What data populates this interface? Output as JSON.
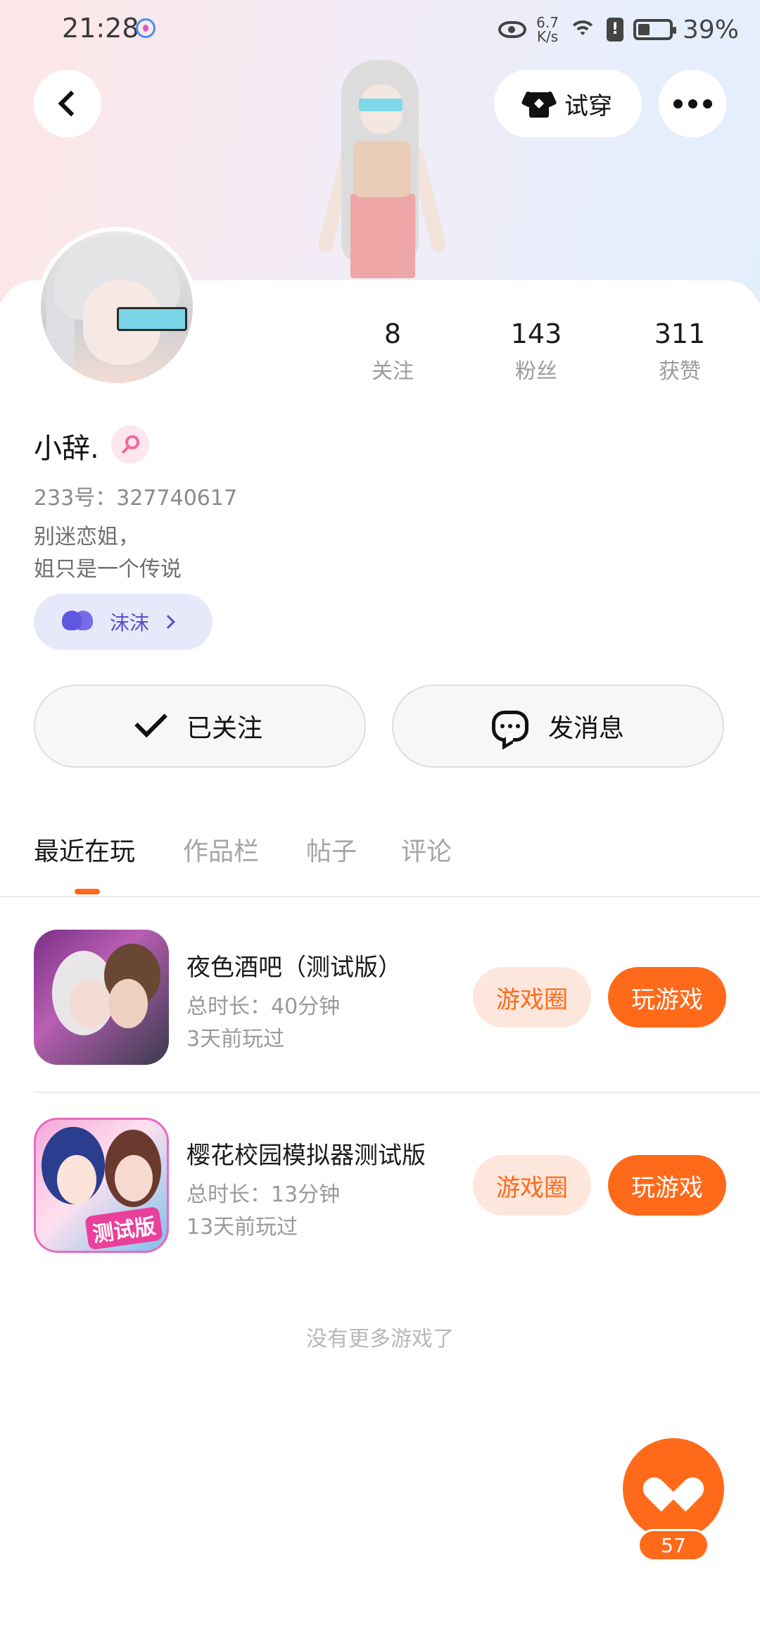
{
  "status_bar": {
    "time": "21:28",
    "net_speed_value": "6.7",
    "net_speed_unit": "K/s",
    "battery": "39%"
  },
  "header": {
    "try_on_label": "试穿",
    "icons": [
      "back-icon",
      "shirt-icon",
      "more-icon"
    ]
  },
  "profile": {
    "name": "小辞.",
    "gender": "female",
    "uid": "233号：327740617",
    "bio_line1": "别迷恋姐，",
    "bio_line2": "姐只是一个传说",
    "couple_label": "沫沫",
    "stats": [
      {
        "value": "8",
        "label": "关注"
      },
      {
        "value": "143",
        "label": "粉丝"
      },
      {
        "value": "311",
        "label": "获赞"
      }
    ]
  },
  "actions": {
    "follow_label": "已关注",
    "message_label": "发消息"
  },
  "tabs": [
    {
      "label": "最近在玩",
      "active": true
    },
    {
      "label": "作品栏",
      "active": false
    },
    {
      "label": "帖子",
      "active": false
    },
    {
      "label": "评论",
      "active": false
    }
  ],
  "games": [
    {
      "title": "夜色酒吧（测试版）",
      "duration": "总时长：40分钟",
      "last_played": "3天前玩过",
      "circle_label": "游戏圈",
      "play_label": "玩游戏"
    },
    {
      "title": "樱花校园模拟器测试版",
      "duration": "总时长：13分钟",
      "last_played": "13天前玩过",
      "circle_label": "游戏圈",
      "play_label": "玩游戏",
      "icon_badge": "测试版"
    }
  ],
  "footer_note": "没有更多游戏了",
  "like_count": "57",
  "colors": {
    "accent": "#ff6a1a",
    "accent_light": "#fde7dc",
    "couple_bg": "#e8e8fb",
    "couple_fg": "#5550c9"
  }
}
